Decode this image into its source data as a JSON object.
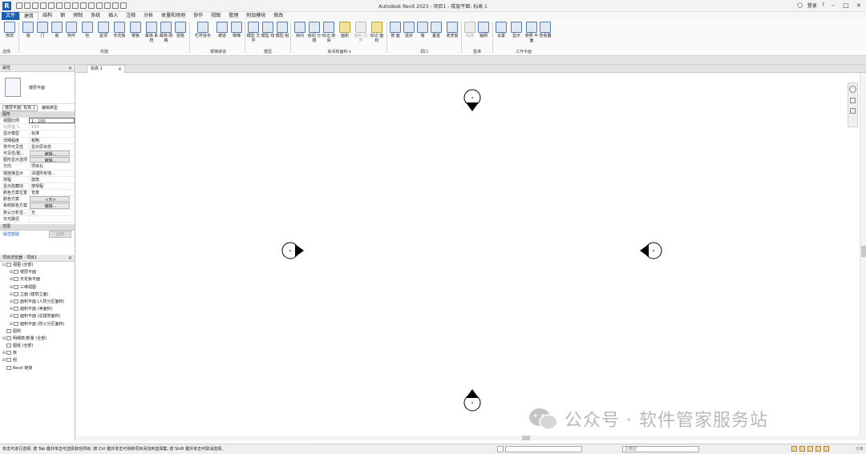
{
  "window": {
    "title": "Autodesk Revit 2023 - 项目1 - 楼层平面: 标高 1",
    "user": "登录",
    "logo_letter": "R"
  },
  "menu": {
    "file": "文件",
    "tabs": [
      "建筑",
      "结构",
      "钢",
      "预制",
      "系统",
      "插入",
      "注释",
      "分析",
      "体量和场地",
      "协作",
      "视图",
      "管理",
      "附加模块",
      "修改"
    ]
  },
  "ribbon": {
    "modify": "修改",
    "select": "选择",
    "build_tools": [
      "墙",
      "门",
      "窗",
      "构件",
      "柱",
      "屋顶",
      "天花板",
      "楼板",
      "幕墙\n系统",
      "幕墙\n网格",
      "竖梃"
    ],
    "circulation_tools": [
      "栏杆扶手",
      "坡道",
      "楼梯"
    ],
    "model_tools": [
      "模型\n文字",
      "模型\n线",
      "模型\n组"
    ],
    "room_tools": [
      "房间",
      "房间\n分隔",
      "标记\n房间",
      "面积",
      "面积\n边界",
      "标记\n面积"
    ],
    "opening_tools": [
      "按\n面",
      "竖井",
      "墙",
      "垂直",
      "老虎窗"
    ],
    "datum_tools": [
      "标高",
      "轴网"
    ],
    "workplane_tools": [
      "设置",
      "显示",
      "参照\n平面",
      "查看器"
    ],
    "groups": {
      "build": "构建",
      "circulation": "楼梯坡道",
      "model": "模型",
      "room": "房间和面积 ▾",
      "opening": "洞口",
      "datum": "基准",
      "workplane": "工作平面"
    }
  },
  "properties": {
    "header": "属性",
    "type_name": "楼层平面",
    "view_selector": "楼层平面: 标高 1",
    "edit_type": "编辑类型",
    "section": "图形",
    "rows": [
      {
        "k": "视图比例",
        "v": "1 : 100"
      },
      {
        "k": "比例值 1:",
        "v": "100"
      },
      {
        "k": "显示模型",
        "v": "标准"
      },
      {
        "k": "详细程度",
        "v": "粗略"
      },
      {
        "k": "零件可见性",
        "v": "显示原状态"
      },
      {
        "k": "可见性/图...",
        "v": "编辑..."
      },
      {
        "k": "图形显示选项",
        "v": "编辑..."
      },
      {
        "k": "方向",
        "v": "项目北"
      },
      {
        "k": "墙连接显示",
        "v": "清理所有墙..."
      },
      {
        "k": "规程",
        "v": "建筑"
      },
      {
        "k": "显示隐藏线",
        "v": "按规程"
      },
      {
        "k": "颜色方案位置",
        "v": "背景"
      },
      {
        "k": "颜色方案",
        "v": "<无>"
      },
      {
        "k": "系统颜色方案",
        "v": "编辑..."
      },
      {
        "k": "默认分析显...",
        "v": "无"
      },
      {
        "k": "日光路径",
        "v": ""
      }
    ],
    "footer_section": "范围",
    "help_link": "属性帮助",
    "apply": "应用"
  },
  "browser": {
    "header": "项目浏览器 - 项目1",
    "items": [
      {
        "label": "视图 (全部)",
        "level": 0,
        "exp": "⊟"
      },
      {
        "label": "楼层平面",
        "level": 1,
        "exp": "⊞"
      },
      {
        "label": "天花板平面",
        "level": 1,
        "exp": "⊞"
      },
      {
        "label": "三维视图",
        "level": 1,
        "exp": "⊞"
      },
      {
        "label": "立面 (建筑立面)",
        "level": 1,
        "exp": "⊞"
      },
      {
        "label": "面积平面 (人防分区面积)",
        "level": 1,
        "exp": "⊞"
      },
      {
        "label": "面积平面 (净面积)",
        "level": 1,
        "exp": "⊞"
      },
      {
        "label": "面积平面 (总建筑面积)",
        "level": 1,
        "exp": "⊞"
      },
      {
        "label": "面积平面 (防火分区面积)",
        "level": 1,
        "exp": "⊞"
      },
      {
        "label": "图例",
        "level": 0,
        "exp": ""
      },
      {
        "label": "明细表/数量 (全部)",
        "level": 0,
        "exp": "⊞"
      },
      {
        "label": "图纸 (全部)",
        "level": 0,
        "exp": ""
      },
      {
        "label": "族",
        "level": 0,
        "exp": "⊞"
      },
      {
        "label": "组",
        "level": 0,
        "exp": "⊞"
      },
      {
        "label": "Revit 链接",
        "level": 0,
        "exp": ""
      }
    ]
  },
  "view_tab": {
    "label": "标高 1"
  },
  "view_control": {
    "scale": "1 : 100"
  },
  "watermark": {
    "text": "公众号 · 软件管家服务站"
  },
  "status": {
    "message": "单击可进行选择; 按 Tab 键并单击可选择其他项目; 按 Ctrl 键并单击可将新项目添加到选择集; 按 Shift 键并单击可取消选择。",
    "workset_value": "",
    "model_combo": "主模型"
  }
}
